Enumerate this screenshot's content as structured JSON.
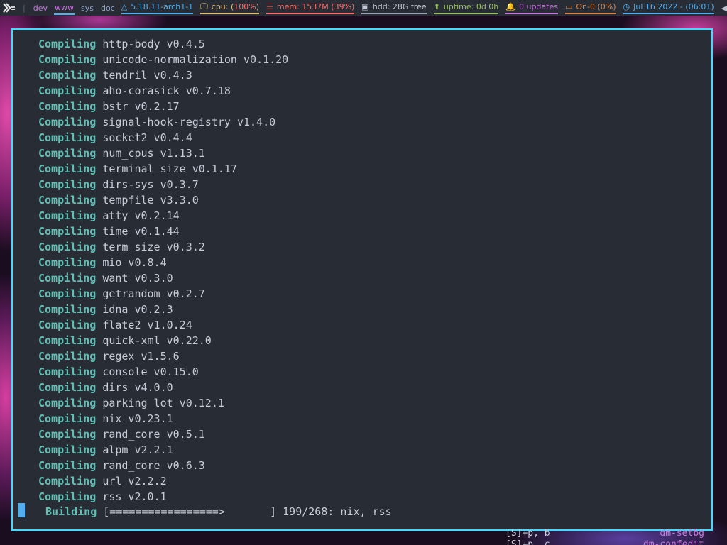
{
  "panel": {
    "logo_icon": "xmonad-logo-icon",
    "workspaces": [
      {
        "label": "dev",
        "active": false
      },
      {
        "label": "www",
        "active": true
      },
      {
        "label": "sys",
        "active": false
      },
      {
        "label": "doc",
        "active": false
      }
    ],
    "kernel": "5.18.11-arch1-1",
    "cpu_label": "cpu: (",
    "cpu_value": "100%",
    "cpu_close": ")",
    "mem": "mem: 1537M (39%)",
    "hdd": "hdd: 28G free",
    "uptime": "uptime: 0d 0h",
    "updates": "0 updates",
    "battery": "On-0 (0%)",
    "clock": "Jul 16 2022 - (06:01)",
    "colors": {
      "kernel": "#51afef",
      "cpu": "#e5c07b",
      "mem": "#ff6c6b",
      "uptime": "#98be65",
      "updates": "#c678dd",
      "battery": "#da8548"
    }
  },
  "terminal": {
    "verb": "Compiling",
    "lines": [
      "http-body v0.4.5",
      "unicode-normalization v0.1.20",
      "tendril v0.4.3",
      "aho-corasick v0.7.18",
      "bstr v0.2.17",
      "signal-hook-registry v1.4.0",
      "socket2 v0.4.4",
      "num_cpus v1.13.1",
      "terminal_size v0.1.17",
      "dirs-sys v0.3.7",
      "tempfile v3.3.0",
      "atty v0.2.14",
      "time v0.1.44",
      "term_size v0.3.2",
      "mio v0.8.4",
      "want v0.3.0",
      "getrandom v0.2.7",
      "idna v0.2.3",
      "flate2 v1.0.24",
      "quick-xml v0.22.0",
      "regex v1.5.6",
      "console v0.15.0",
      "dirs v4.0.0",
      "parking_lot v0.12.1",
      "nix v0.23.1",
      "rand_core v0.5.1",
      "alpm v2.2.1",
      "rand_core v0.6.3",
      "url v2.2.2",
      "rss v2.0.1"
    ],
    "building_label": "Building",
    "progress_bar": "[=================>       ]",
    "progress_text": "199/268: nix, rss",
    "progress_fraction": 0.743
  },
  "background_window": {
    "rows": [
      {
        "key": "[S]+p, b",
        "cmd": "dm-setbg"
      },
      {
        "key": "[S]+p, c",
        "cmd": "dm-confedit"
      }
    ]
  }
}
